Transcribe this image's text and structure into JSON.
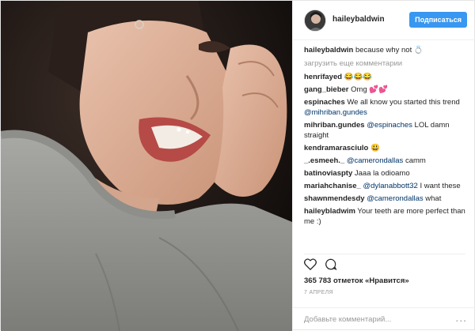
{
  "header": {
    "username": "haileybaldwin",
    "follow_label": "Подписаться"
  },
  "caption": {
    "username": "haileybaldwin",
    "text": "because why not ",
    "emoji": "💍"
  },
  "load_more_label": "загрузить еще комментарии",
  "comments": [
    {
      "user": "henrifayed",
      "parts": [
        {
          "t": "😂😂😂"
        }
      ]
    },
    {
      "user": "gang_bieber",
      "parts": [
        {
          "t": "Omg 💕💕"
        }
      ]
    },
    {
      "user": "espinaches",
      "parts": [
        {
          "t": "We all know you started this trend "
        },
        {
          "m": "@mihriban.gundes"
        }
      ]
    },
    {
      "user": "mihriban.gundes",
      "parts": [
        {
          "m": "@espinaches"
        },
        {
          "t": " LOL damn straight"
        }
      ]
    },
    {
      "user": "kendramarasciulo",
      "parts": [
        {
          "t": "😃"
        }
      ]
    },
    {
      "user": "_.esmeeh._",
      "parts": [
        {
          "m": "@camerondallas"
        },
        {
          "t": " camm"
        }
      ]
    },
    {
      "user": "batinoviaspty",
      "parts": [
        {
          "t": "Jaaa la odioamo"
        }
      ]
    },
    {
      "user": "mariahchanise_",
      "parts": [
        {
          "m": "@dylanabbott32"
        },
        {
          "t": " I want these"
        }
      ]
    },
    {
      "user": "shawnmendesdy",
      "parts": [
        {
          "m": "@camerondallas"
        },
        {
          "t": " what"
        }
      ]
    },
    {
      "user": "haileybladwim",
      "parts": [
        {
          "t": "Your teeth are more perfect than me :)"
        }
      ]
    }
  ],
  "likes_text": "365 783 отметок «Нравится»",
  "date_text": "7 АПРЕЛЯ",
  "add_comment_placeholder": "Добавьте комментарий...",
  "more_label": "...",
  "colors": {
    "accent": "#3897f0",
    "mention": "#003569",
    "muted": "#999999"
  }
}
